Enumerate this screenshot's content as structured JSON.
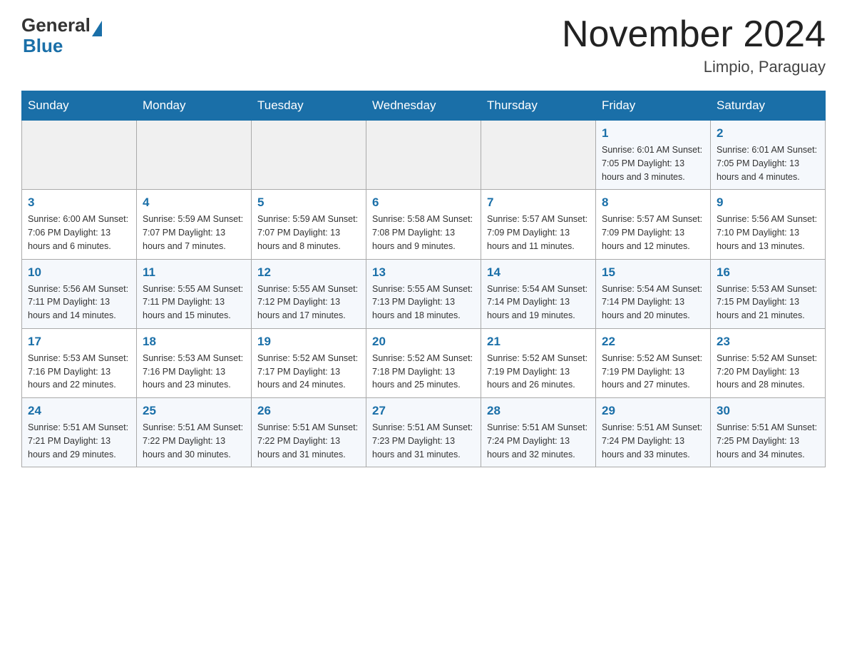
{
  "logo": {
    "general": "General",
    "blue": "Blue"
  },
  "header": {
    "title": "November 2024",
    "location": "Limpio, Paraguay"
  },
  "days_of_week": [
    "Sunday",
    "Monday",
    "Tuesday",
    "Wednesday",
    "Thursday",
    "Friday",
    "Saturday"
  ],
  "weeks": [
    [
      {
        "day": "",
        "info": ""
      },
      {
        "day": "",
        "info": ""
      },
      {
        "day": "",
        "info": ""
      },
      {
        "day": "",
        "info": ""
      },
      {
        "day": "",
        "info": ""
      },
      {
        "day": "1",
        "info": "Sunrise: 6:01 AM\nSunset: 7:05 PM\nDaylight: 13 hours\nand 3 minutes."
      },
      {
        "day": "2",
        "info": "Sunrise: 6:01 AM\nSunset: 7:05 PM\nDaylight: 13 hours\nand 4 minutes."
      }
    ],
    [
      {
        "day": "3",
        "info": "Sunrise: 6:00 AM\nSunset: 7:06 PM\nDaylight: 13 hours\nand 6 minutes."
      },
      {
        "day": "4",
        "info": "Sunrise: 5:59 AM\nSunset: 7:07 PM\nDaylight: 13 hours\nand 7 minutes."
      },
      {
        "day": "5",
        "info": "Sunrise: 5:59 AM\nSunset: 7:07 PM\nDaylight: 13 hours\nand 8 minutes."
      },
      {
        "day": "6",
        "info": "Sunrise: 5:58 AM\nSunset: 7:08 PM\nDaylight: 13 hours\nand 9 minutes."
      },
      {
        "day": "7",
        "info": "Sunrise: 5:57 AM\nSunset: 7:09 PM\nDaylight: 13 hours\nand 11 minutes."
      },
      {
        "day": "8",
        "info": "Sunrise: 5:57 AM\nSunset: 7:09 PM\nDaylight: 13 hours\nand 12 minutes."
      },
      {
        "day": "9",
        "info": "Sunrise: 5:56 AM\nSunset: 7:10 PM\nDaylight: 13 hours\nand 13 minutes."
      }
    ],
    [
      {
        "day": "10",
        "info": "Sunrise: 5:56 AM\nSunset: 7:11 PM\nDaylight: 13 hours\nand 14 minutes."
      },
      {
        "day": "11",
        "info": "Sunrise: 5:55 AM\nSunset: 7:11 PM\nDaylight: 13 hours\nand 15 minutes."
      },
      {
        "day": "12",
        "info": "Sunrise: 5:55 AM\nSunset: 7:12 PM\nDaylight: 13 hours\nand 17 minutes."
      },
      {
        "day": "13",
        "info": "Sunrise: 5:55 AM\nSunset: 7:13 PM\nDaylight: 13 hours\nand 18 minutes."
      },
      {
        "day": "14",
        "info": "Sunrise: 5:54 AM\nSunset: 7:14 PM\nDaylight: 13 hours\nand 19 minutes."
      },
      {
        "day": "15",
        "info": "Sunrise: 5:54 AM\nSunset: 7:14 PM\nDaylight: 13 hours\nand 20 minutes."
      },
      {
        "day": "16",
        "info": "Sunrise: 5:53 AM\nSunset: 7:15 PM\nDaylight: 13 hours\nand 21 minutes."
      }
    ],
    [
      {
        "day": "17",
        "info": "Sunrise: 5:53 AM\nSunset: 7:16 PM\nDaylight: 13 hours\nand 22 minutes."
      },
      {
        "day": "18",
        "info": "Sunrise: 5:53 AM\nSunset: 7:16 PM\nDaylight: 13 hours\nand 23 minutes."
      },
      {
        "day": "19",
        "info": "Sunrise: 5:52 AM\nSunset: 7:17 PM\nDaylight: 13 hours\nand 24 minutes."
      },
      {
        "day": "20",
        "info": "Sunrise: 5:52 AM\nSunset: 7:18 PM\nDaylight: 13 hours\nand 25 minutes."
      },
      {
        "day": "21",
        "info": "Sunrise: 5:52 AM\nSunset: 7:19 PM\nDaylight: 13 hours\nand 26 minutes."
      },
      {
        "day": "22",
        "info": "Sunrise: 5:52 AM\nSunset: 7:19 PM\nDaylight: 13 hours\nand 27 minutes."
      },
      {
        "day": "23",
        "info": "Sunrise: 5:52 AM\nSunset: 7:20 PM\nDaylight: 13 hours\nand 28 minutes."
      }
    ],
    [
      {
        "day": "24",
        "info": "Sunrise: 5:51 AM\nSunset: 7:21 PM\nDaylight: 13 hours\nand 29 minutes."
      },
      {
        "day": "25",
        "info": "Sunrise: 5:51 AM\nSunset: 7:22 PM\nDaylight: 13 hours\nand 30 minutes."
      },
      {
        "day": "26",
        "info": "Sunrise: 5:51 AM\nSunset: 7:22 PM\nDaylight: 13 hours\nand 31 minutes."
      },
      {
        "day": "27",
        "info": "Sunrise: 5:51 AM\nSunset: 7:23 PM\nDaylight: 13 hours\nand 31 minutes."
      },
      {
        "day": "28",
        "info": "Sunrise: 5:51 AM\nSunset: 7:24 PM\nDaylight: 13 hours\nand 32 minutes."
      },
      {
        "day": "29",
        "info": "Sunrise: 5:51 AM\nSunset: 7:24 PM\nDaylight: 13 hours\nand 33 minutes."
      },
      {
        "day": "30",
        "info": "Sunrise: 5:51 AM\nSunset: 7:25 PM\nDaylight: 13 hours\nand 34 minutes."
      }
    ]
  ]
}
